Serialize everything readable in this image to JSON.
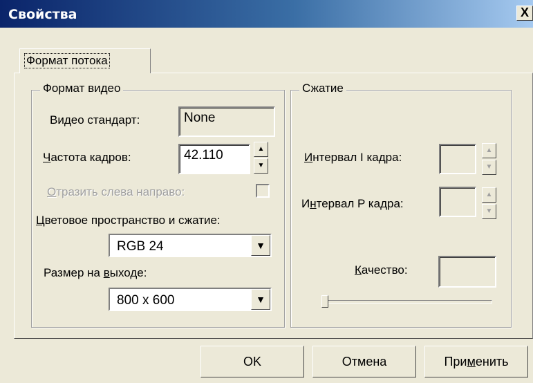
{
  "window": {
    "title": "Свойства",
    "close_label": "X"
  },
  "tabs": [
    {
      "label": "Формат потока"
    }
  ],
  "video_group": {
    "legend": "Формат видео",
    "standard_label": "Видео стандарт:",
    "standard_value": "None",
    "framerate_label_first": "Ч",
    "framerate_label_rest": "астота кадров:",
    "framerate_value": "42.110",
    "mirror_label_first": "О",
    "mirror_label_rest": "тразить слева направо:",
    "mirror_checked": false,
    "colorspace_label_first": "Ц",
    "colorspace_label_rest": "ветовое пространство и сжатие:",
    "colorspace_value": "RGB 24",
    "output_size_label_pre": "Размер на ",
    "output_size_label_u": "в",
    "output_size_label_post": "ыходе:",
    "output_size_value": "800 x 600"
  },
  "compression_group": {
    "legend": "Сжатие",
    "i_interval_label_first": "И",
    "i_interval_label_rest": "нтервал I кадра:",
    "p_interval_label_pre": "И",
    "p_interval_label_u": "н",
    "p_interval_label_post": "тервал P кадра:",
    "quality_label_first": "К",
    "quality_label_rest": "ачество:",
    "quality_slider_level": 0
  },
  "buttons": {
    "ok": "OK",
    "cancel": "Отмена",
    "apply_pre": "При",
    "apply_u": "м",
    "apply_post": "енить"
  },
  "icons": {
    "spin_up": "arrow-up-icon",
    "spin_down": "arrow-down-icon",
    "dropdown": "chevron-down-icon"
  }
}
